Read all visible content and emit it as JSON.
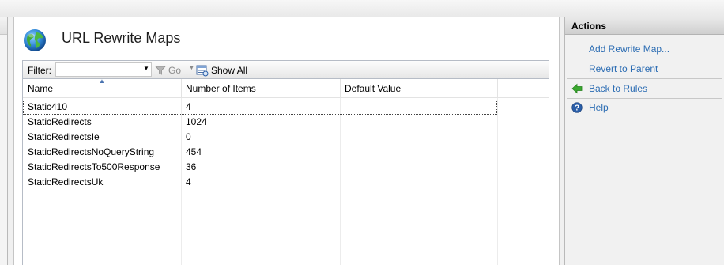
{
  "header": {
    "title": "URL Rewrite Maps",
    "icon": "globe-icon"
  },
  "toolbar": {
    "filter_label": "Filter:",
    "filter_value": "",
    "go_label": "Go",
    "show_all_label": "Show All"
  },
  "grid": {
    "columns": [
      "Name",
      "Number of Items",
      "Default Value"
    ],
    "rows": [
      {
        "name": "Static410",
        "items": "4",
        "default": ""
      },
      {
        "name": "StaticRedirects",
        "items": "1024",
        "default": ""
      },
      {
        "name": "StaticRedirectsIe",
        "items": "0",
        "default": ""
      },
      {
        "name": "StaticRedirectsNoQueryString",
        "items": "454",
        "default": ""
      },
      {
        "name": "StaticRedirectsTo500Response",
        "items": "36",
        "default": ""
      },
      {
        "name": "StaticRedirectsUk",
        "items": "4",
        "default": ""
      }
    ],
    "selected_row": 0
  },
  "actions": {
    "title": "Actions",
    "add_rewrite_map": "Add Rewrite Map...",
    "revert_to_parent": "Revert to Parent",
    "back_to_rules": "Back to Rules",
    "help": "Help"
  },
  "colors": {
    "link": "#2b6cb3",
    "back_arrow": "#3aa82f",
    "help_icon": "#2a5ea8"
  }
}
